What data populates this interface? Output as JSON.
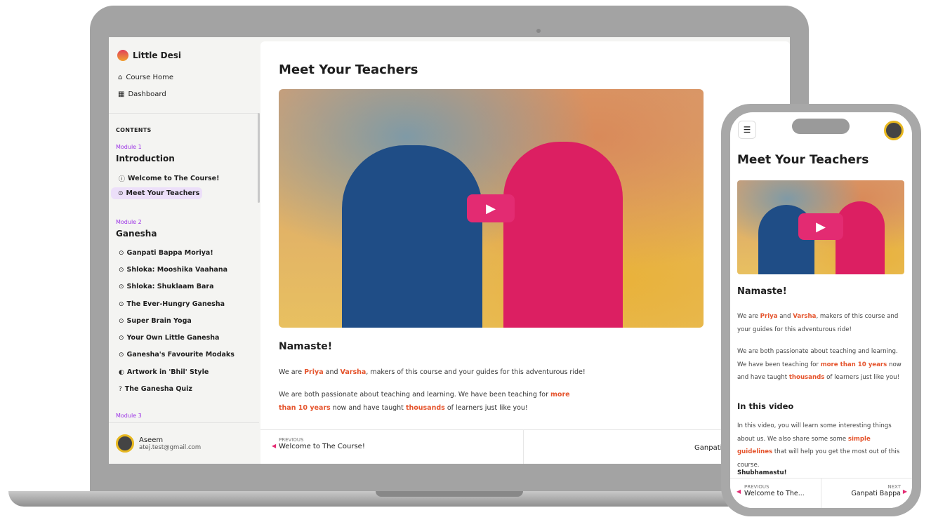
{
  "brand": "Little Desi",
  "nav": {
    "home": "Course Home",
    "dashboard": "Dashboard"
  },
  "contents_label": "CONTENTS",
  "modules": [
    {
      "label": "Module 1",
      "title": "Introduction",
      "lessons": [
        "Welcome to The Course!",
        "Meet Your Teachers"
      ]
    },
    {
      "label": "Module 2",
      "title": "Ganesha",
      "lessons": [
        "Ganpati Bappa Moriya!",
        "Shloka: Mooshika Vaahana",
        "Shloka: Shuklaam Bara",
        "The Ever-Hungry Ganesha",
        "Super Brain Yoga",
        "Your Own Little Ganesha",
        "Ganesha's Favourite Modaks",
        "Artwork in 'Bhil' Style",
        "The Ganesha Quiz"
      ]
    },
    {
      "label": "Module 3"
    }
  ],
  "active_lesson": "Meet Your Teachers",
  "user": {
    "name": "Aseem",
    "email": "atej.test@gmail.com"
  },
  "page": {
    "title": "Meet Your Teachers",
    "greeting": "Namaste!",
    "p1": [
      "We are ",
      "Priya",
      " and ",
      "Varsha",
      ", makers of this course and your guides for this adventurous ride!"
    ],
    "p2": [
      "We are both passionate about teaching and learning. We have been teaching for ",
      "more than 10 years",
      " now and have taught ",
      "thousands",
      " of learners just like you!"
    ],
    "in_video_title": "In this video",
    "p3": [
      "In this video, you will learn some interesting things about us. We also share some some ",
      "simple guidelines",
      " that will help you get the most out of this course."
    ],
    "signoff": "Shubhamastu!"
  },
  "pager": {
    "previous_label": "PREVIOUS",
    "previous": "Welcome to The Course!",
    "previous_short": "Welcome to The...",
    "next_label": "NEXT",
    "next": "Ganpati",
    "next_mobile": "Ganpati Bappa"
  },
  "colors": {
    "accent": "#e32b72",
    "module": "#9b32e6",
    "highlight": "#e5552e"
  }
}
